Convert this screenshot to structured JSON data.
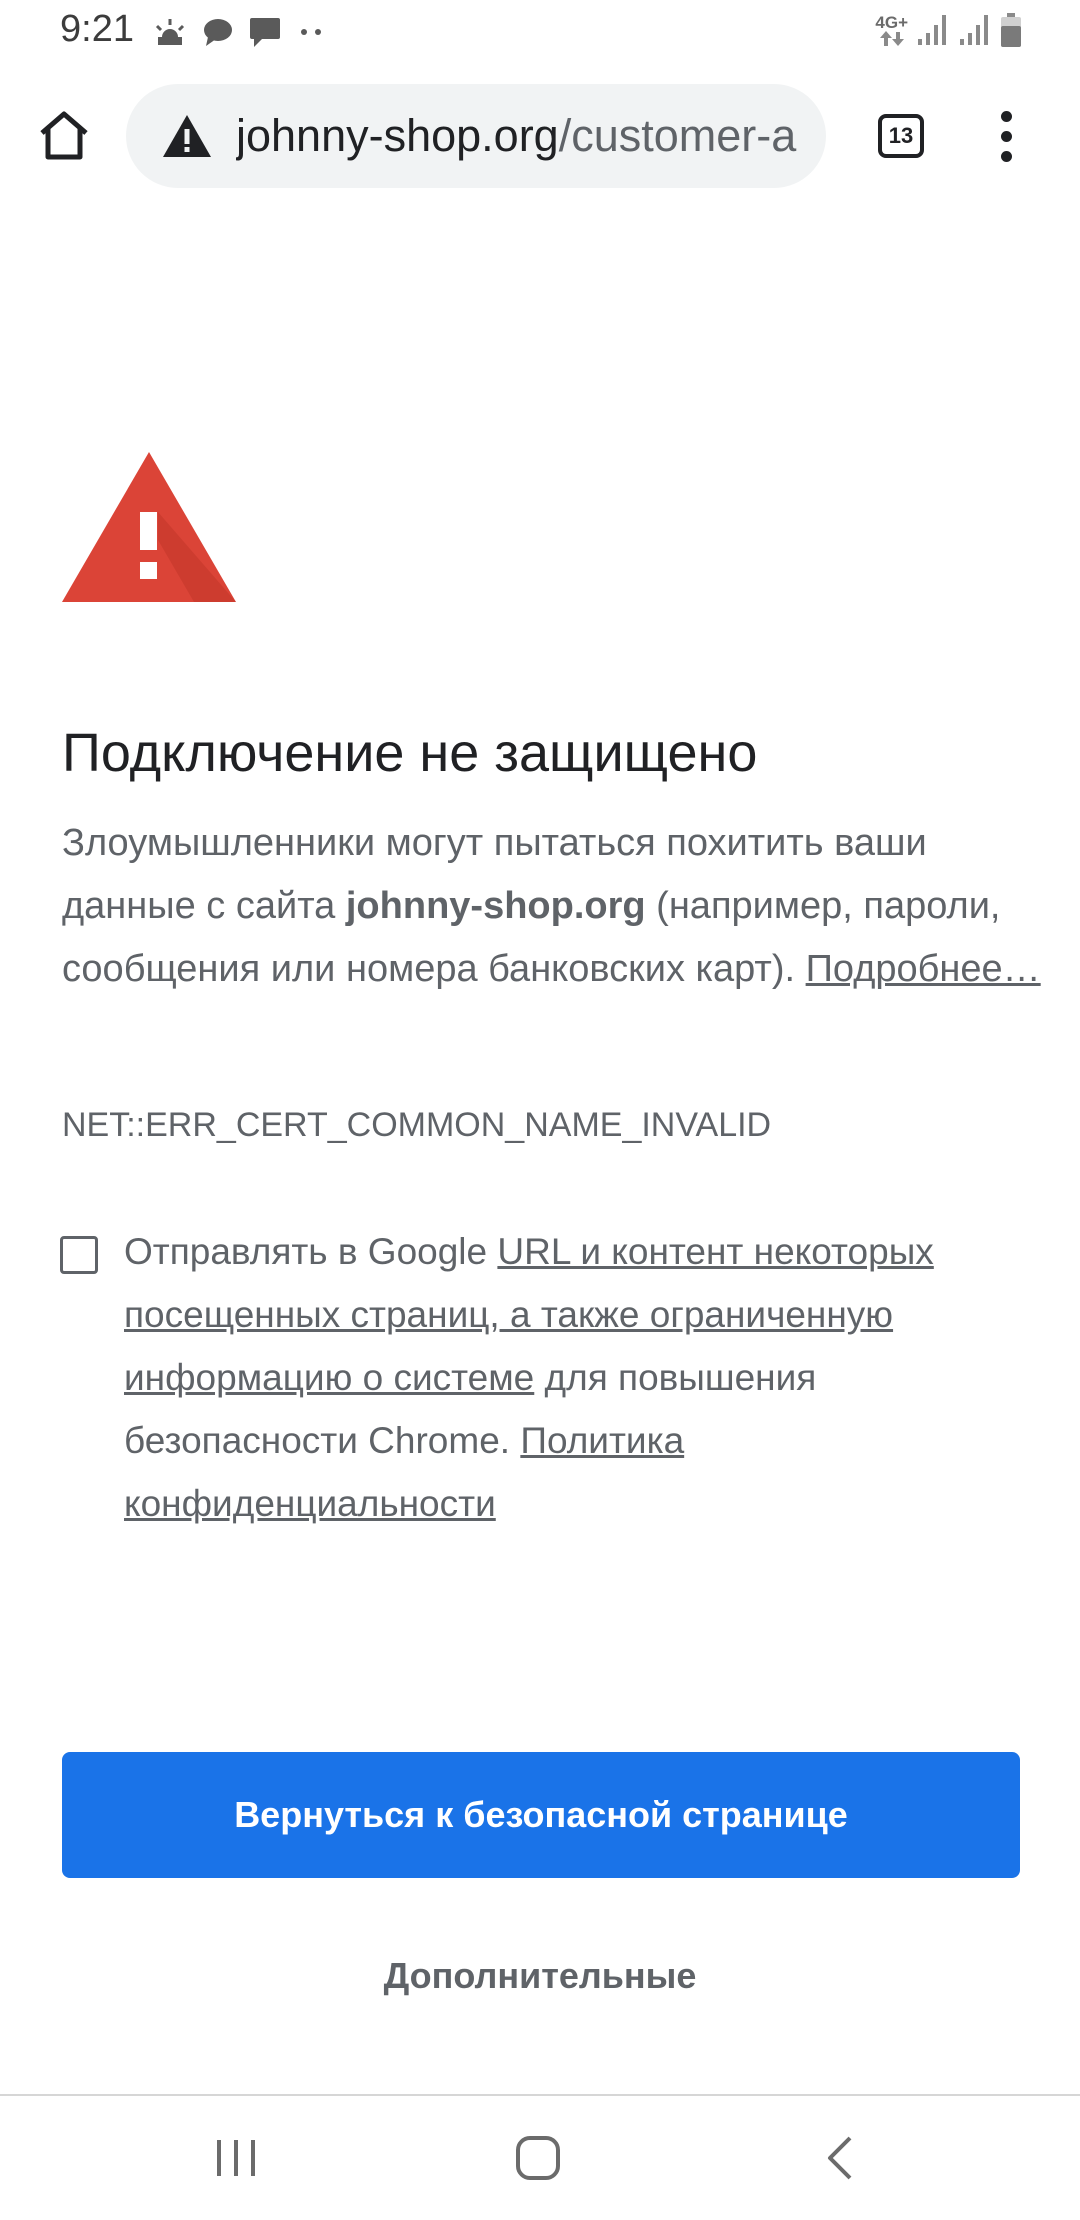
{
  "status_bar": {
    "time": "9:21",
    "network_label": "4G+",
    "left_icons": [
      "weather-icon",
      "chat-bubble-icon",
      "message-icon",
      "more-dots-icon"
    ],
    "right_icons": [
      "network-4g-icon",
      "signal-icon",
      "signal-icon",
      "battery-icon"
    ]
  },
  "toolbar": {
    "url_host": "johnny-shop.org",
    "url_path": "/customer-a",
    "tab_count": "13",
    "security_icon": "warning-icon"
  },
  "interstitial": {
    "title": "Подключение не защищено",
    "body_before_host": "Злоумышленники могут пытаться похитить ваши данные с сайта ",
    "host": "johnny-shop.org",
    "body_after_host": " (например, пароли, сообщения или номера банковских карт). ",
    "learn_more_link": "Подробнее…",
    "error_code": "NET::ERR_CERT_COMMON_NAME_INVALID",
    "optin": {
      "checked": false,
      "text_before_link": "Отправлять в Google ",
      "link_1": "URL и контент некоторых посещенных страниц, а также ограниченную информацию о системе",
      "text_middle": " для повышения безопасности Chrome. ",
      "link_2": "Политика конфиденциальности"
    },
    "primary_button": "Вернуться к безопасной странице",
    "details_button": "Дополнительные"
  },
  "colors": {
    "primary_blue": "#1a73e8",
    "warning_red": "#db4437",
    "text_secondary": "#5f6368",
    "omnibox_bg": "#f1f3f4"
  },
  "nav_bar": {
    "buttons": [
      "recent-apps-icon",
      "home-icon",
      "back-icon"
    ]
  }
}
